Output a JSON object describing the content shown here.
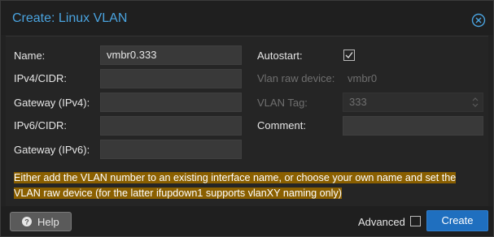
{
  "dialog": {
    "title": "Create: Linux VLAN",
    "close_icon": "close-circle-icon"
  },
  "form": {
    "name_label": "Name:",
    "name_value": "vmbr0.333",
    "ipv4_label": "IPv4/CIDR:",
    "ipv4_value": "",
    "gateway4_label": "Gateway (IPv4):",
    "gateway4_value": "",
    "ipv6_label": "IPv6/CIDR:",
    "ipv6_value": "",
    "gateway6_label": "Gateway (IPv6):",
    "gateway6_value": "",
    "autostart_label": "Autostart:",
    "autostart_checked": true,
    "vlan_raw_label": "Vlan raw device:",
    "vlan_raw_value": "vmbr0",
    "vlan_tag_label": "VLAN Tag:",
    "vlan_tag_value": "333",
    "comment_label": "Comment:",
    "comment_value": ""
  },
  "notice": {
    "text": "Either add the VLAN number to an existing interface name, or choose your own name and set the VLAN raw device (for the latter ifupdown1 supports vlanXY naming only)",
    "color": "#8a5f00"
  },
  "footer": {
    "help_label": "Help",
    "help_icon": "question-circle-icon",
    "advanced_label": "Advanced",
    "advanced_checked": false,
    "create_label": "Create"
  },
  "colors": {
    "accent": "#4aa3df",
    "primary_button": "#1f6fbf"
  }
}
